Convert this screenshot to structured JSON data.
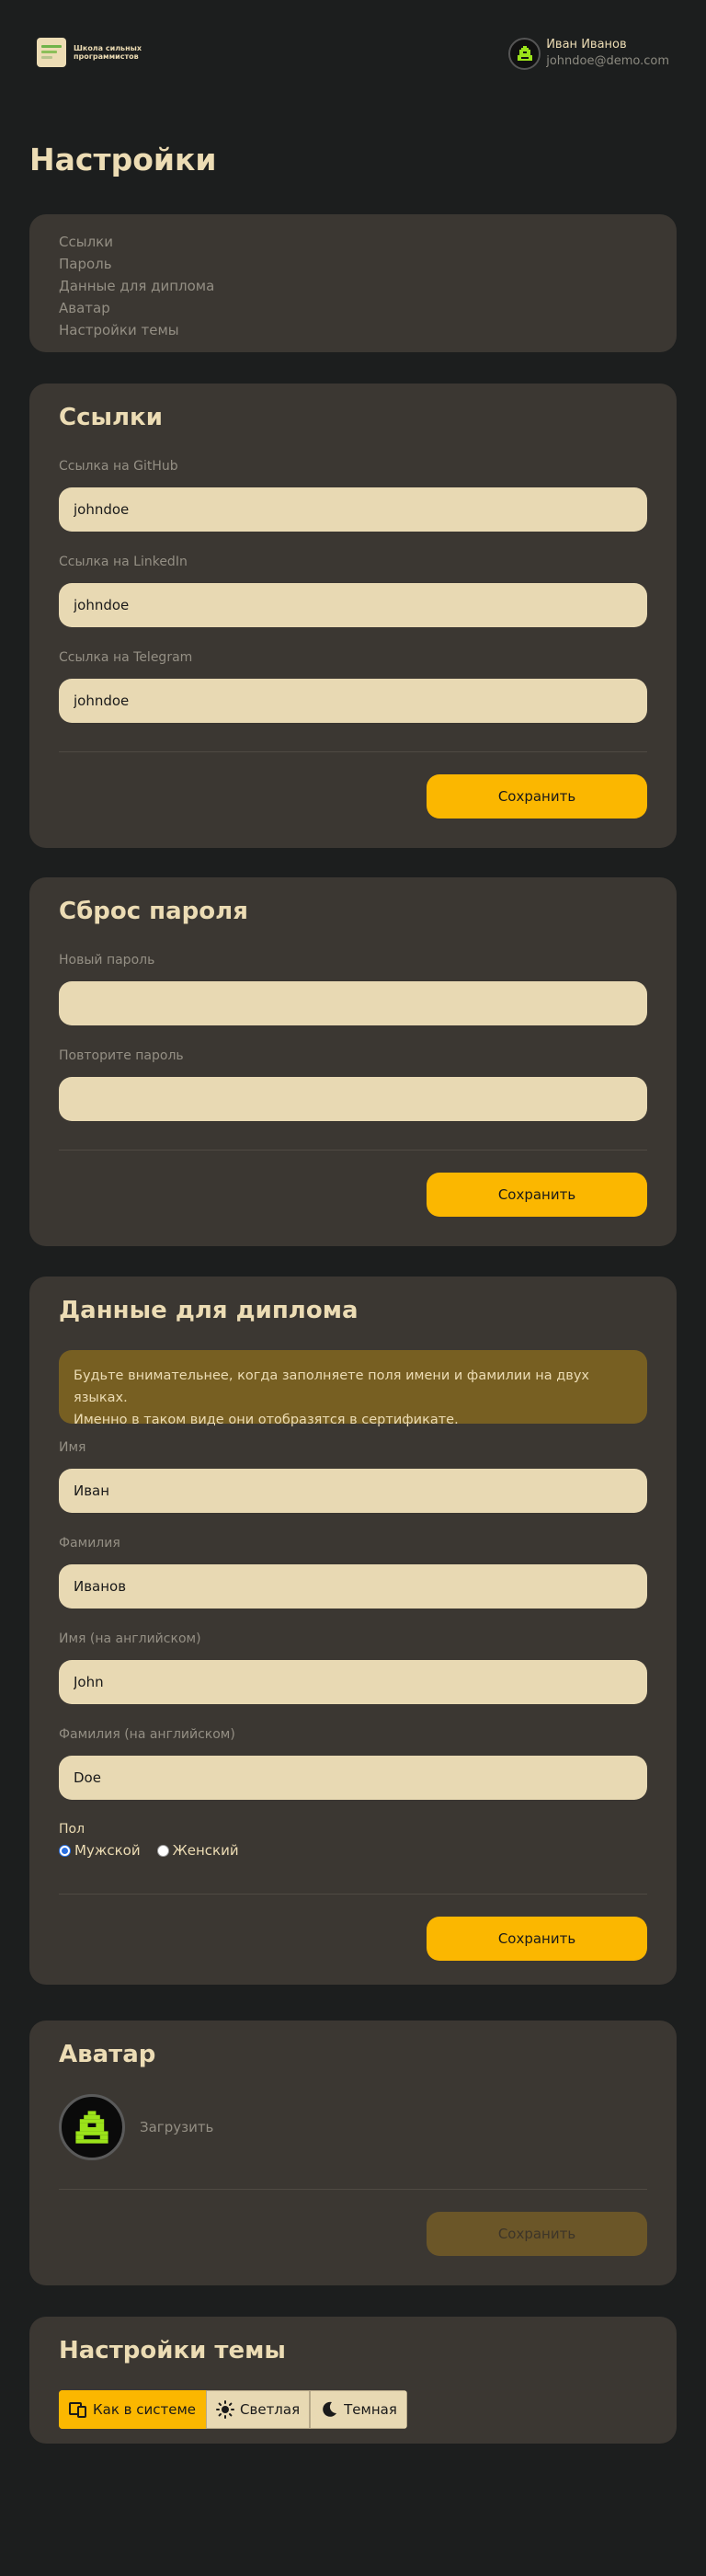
{
  "brand": {
    "logo_text": "Школа сильных программистов"
  },
  "user": {
    "name": "Иван Иванов",
    "email": "johndoe@demo.com"
  },
  "page_title": "Настройки",
  "toc": [
    "Ссылки",
    "Пароль",
    "Данные для диплома",
    "Аватар",
    "Настройки темы"
  ],
  "links": {
    "title": "Ссылки",
    "github_label": "Ссылка на GitHub",
    "github_value": "johndoe",
    "linkedin_label": "Ссылка на LinkedIn",
    "linkedin_value": "johndoe",
    "telegram_label": "Ссылка на Telegram",
    "telegram_value": "johndoe",
    "save_label": "Сохранить"
  },
  "password": {
    "title": "Сброс пароля",
    "new_label": "Новый пароль",
    "new_value": "",
    "repeat_label": "Повторите пароль",
    "repeat_value": "",
    "save_label": "Сохранить"
  },
  "diploma": {
    "title": "Данные для диплома",
    "notice_line1": "Будьте внимательнее, когда заполняете поля имени и фамилии на двух языках.",
    "notice_line2": "Именно в таком виде они отобразятся в сертификате.",
    "first_name_label": "Имя",
    "first_name_value": "Иван",
    "last_name_label": "Фамилия",
    "last_name_value": "Иванов",
    "first_name_en_label": "Имя (на английском)",
    "first_name_en_value": "John",
    "last_name_en_label": "Фамилия (на английском)",
    "last_name_en_value": "Doe",
    "gender_label": "Пол",
    "gender_male": "Мужской",
    "gender_female": "Женский",
    "gender_selected": "male",
    "save_label": "Сохранить"
  },
  "avatar": {
    "title": "Аватар",
    "upload_label": "Загрузить",
    "save_label": "Сохранить",
    "save_disabled": true
  },
  "theme": {
    "title": "Настройки темы",
    "options": [
      "Как в системе",
      "Светлая",
      "Темная"
    ],
    "selected": "Как в системе"
  },
  "colors": {
    "accent": "#fbb700",
    "card": "#3b3732",
    "background": "#1c1e1e",
    "input": "#e8d9b3",
    "avatar_green": "#9be31a"
  }
}
